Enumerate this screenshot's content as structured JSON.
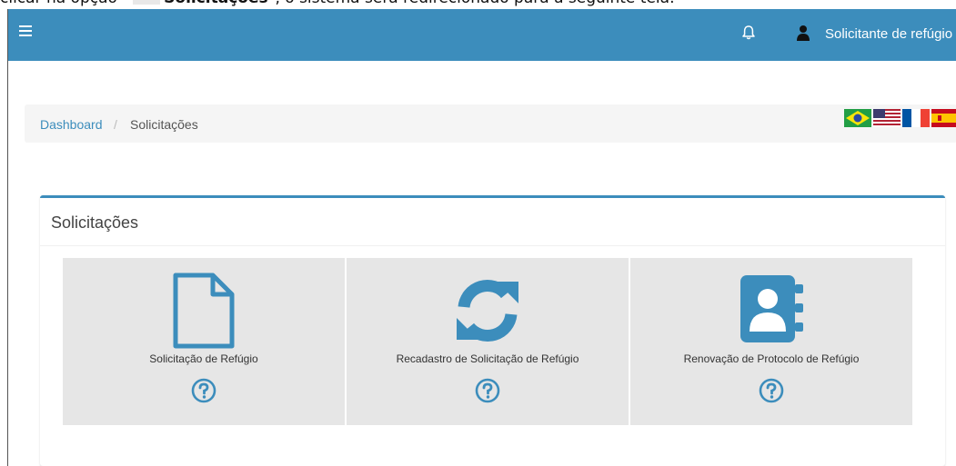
{
  "doc_caption": {
    "before": "clicar na opção \"",
    "bold": "Solicitações",
    "after": "\", o sistema será redirecionado para a seguinte tela:"
  },
  "header": {
    "user_label": "Solicitante de refúgio"
  },
  "breadcrumb": {
    "home": "Dashboard",
    "separator": "/",
    "current": "Solicitações"
  },
  "languages": [
    "Português (Brasil)",
    "English (US)",
    "Français",
    "Español"
  ],
  "box": {
    "title": "Solicitações",
    "tiles": [
      {
        "label": "Solicitação de Refúgio",
        "icon": "document-icon"
      },
      {
        "label": "Recadastro de Solicitação de Refúgio",
        "icon": "refresh-icon"
      },
      {
        "label": "Renovação de Protocolo de Refúgio",
        "icon": "contact-book-icon"
      }
    ]
  },
  "colors": {
    "brand": "#3c8dbc",
    "tile_bg": "#e6e6e6",
    "breadcrumb_bg": "#f5f5f5"
  }
}
